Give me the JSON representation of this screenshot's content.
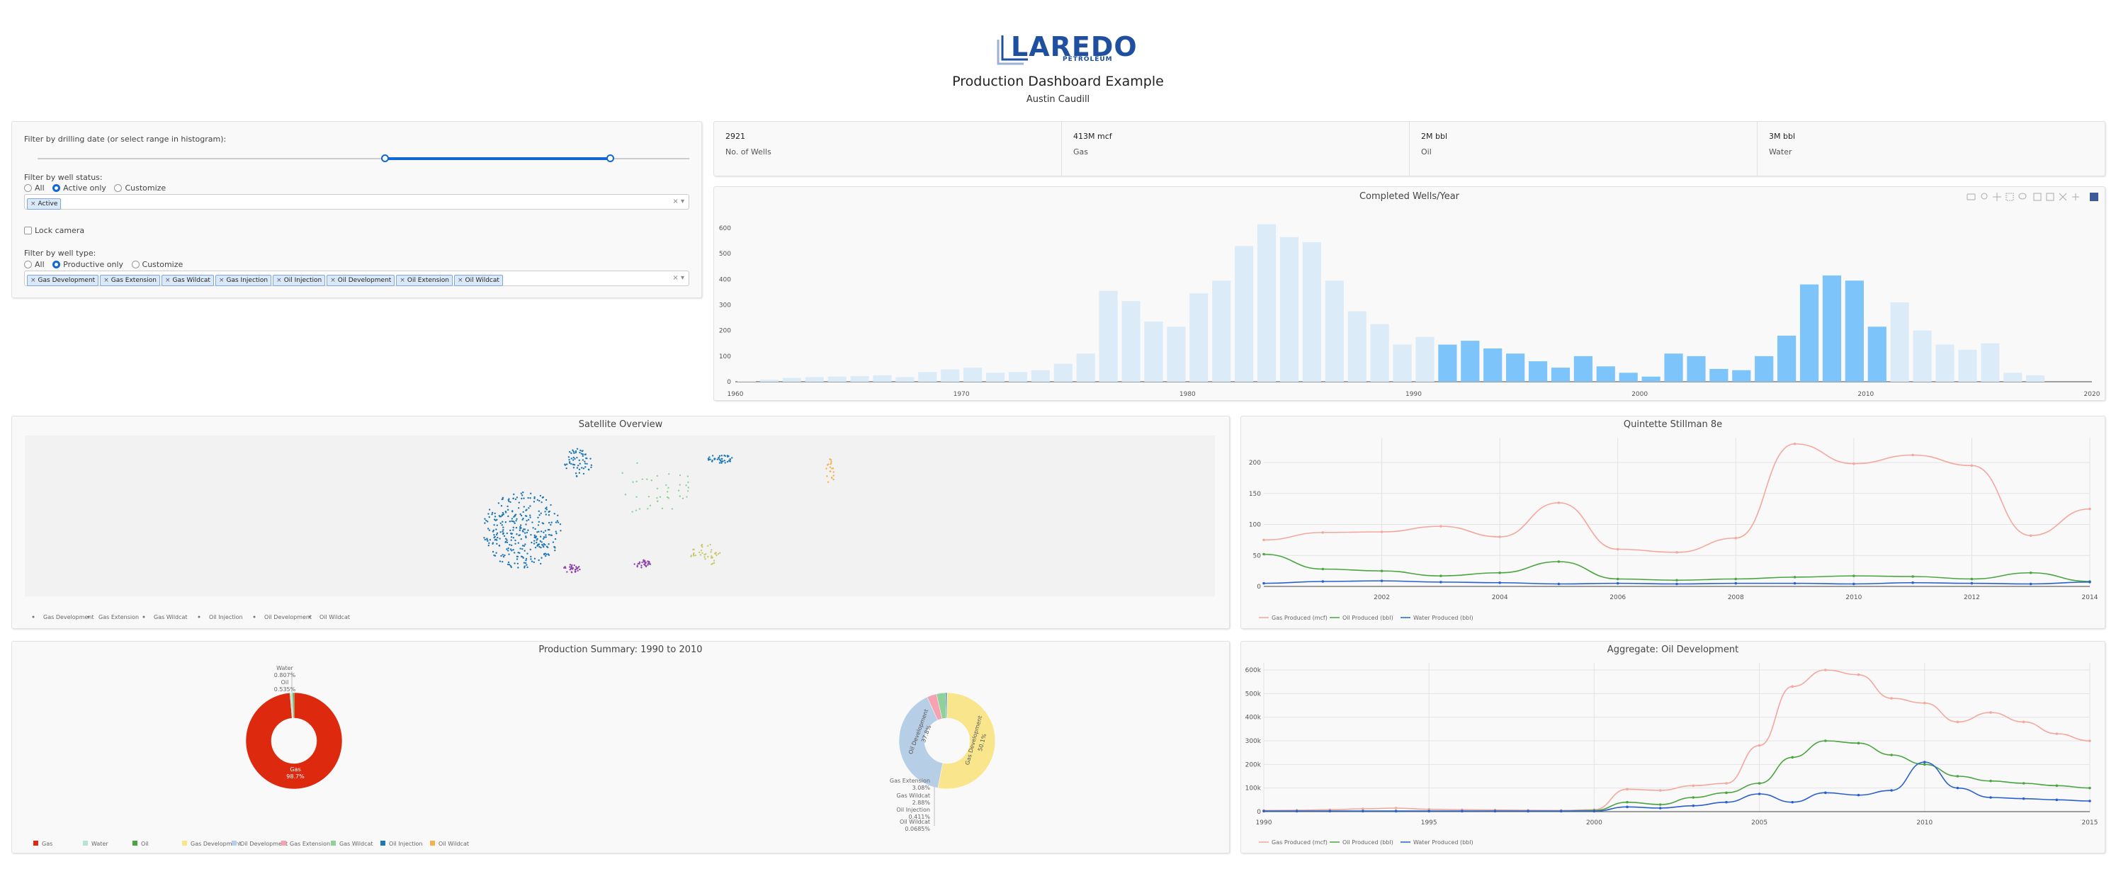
{
  "header": {
    "logo_text": "LAREDO",
    "logo_sub": "PETROLEUM",
    "title": "Production Dashboard Example",
    "author": "Austin Caudill"
  },
  "controls": {
    "date_label": "Filter by drilling date (or select range in histogram):",
    "date_range": {
      "start": 1990,
      "end": 2010,
      "min": 1960,
      "max": 2020
    },
    "status_label": "Filter by well status:",
    "status_options": [
      "All",
      "Active only",
      "Customize"
    ],
    "status_selected": "Active only",
    "status_tags": [
      "Active"
    ],
    "lock_camera": "Lock camera",
    "type_label": "Filter by well type:",
    "type_options": [
      "All",
      "Productive only",
      "Customize"
    ],
    "type_selected": "Productive only",
    "type_tags": [
      "Gas Development",
      "Gas Extension",
      "Gas Wildcat",
      "Gas Injection",
      "Oil Injection",
      "Oil Development",
      "Oil Extension",
      "Oil Wildcat"
    ],
    "clear_glyph": "×",
    "caret_glyph": "▾"
  },
  "stats": [
    {
      "value": "2921",
      "label": "No. of Wells"
    },
    {
      "value": "413M mcf",
      "label": "Gas"
    },
    {
      "value": "2M bbl",
      "label": "Oil"
    },
    {
      "value": "3M bbl",
      "label": "Water"
    }
  ],
  "colors": {
    "accent": "#1166d8",
    "bar_selected": "#7cc4fa",
    "bar_dim": "#dcebf8",
    "gas": "#f4a79d",
    "oil": "#4aa540",
    "water": "#2a5fd0"
  },
  "icons": [
    "camera-icon",
    "zoom-icon",
    "pan-icon",
    "box-select-icon",
    "lasso-icon",
    "zoom-in-icon",
    "zoom-out-icon",
    "autoscale-icon",
    "reset-icon",
    "plotly-logo-icon"
  ],
  "chart_data": [
    {
      "type": "bar",
      "title": "Completed Wells/Year",
      "x": [
        1960,
        1961,
        1962,
        1963,
        1964,
        1965,
        1966,
        1967,
        1968,
        1969,
        1970,
        1971,
        1972,
        1973,
        1974,
        1975,
        1976,
        1977,
        1978,
        1979,
        1980,
        1981,
        1982,
        1983,
        1984,
        1985,
        1986,
        1987,
        1988,
        1989,
        1990,
        1991,
        1992,
        1993,
        1994,
        1995,
        1996,
        1997,
        1998,
        1999,
        2000,
        2001,
        2002,
        2003,
        2004,
        2005,
        2006,
        2007,
        2008,
        2009,
        2010,
        2011,
        2012,
        2013,
        2014,
        2015,
        2016,
        2017
      ],
      "values": [
        2,
        8,
        15,
        18,
        20,
        22,
        25,
        18,
        38,
        48,
        55,
        35,
        38,
        45,
        70,
        110,
        355,
        315,
        235,
        215,
        345,
        395,
        530,
        615,
        565,
        545,
        395,
        275,
        225,
        145,
        175,
        145,
        160,
        130,
        110,
        80,
        55,
        100,
        60,
        35,
        20,
        110,
        100,
        50,
        45,
        100,
        180,
        380,
        415,
        395,
        215,
        310,
        200,
        145,
        125,
        150,
        35,
        25
      ],
      "selected_range": [
        1991,
        2010
      ],
      "xticks": [
        1960,
        1970,
        1980,
        1990,
        2000,
        2010,
        2020
      ],
      "yticks": [
        0,
        100,
        200,
        300,
        400,
        500,
        600
      ],
      "ylim": [
        0,
        650
      ]
    },
    {
      "type": "scatter",
      "title": "Satellite Overview",
      "legend": [
        "Gas Development",
        "Gas Extension",
        "Gas Wildcat",
        "Oil Injection",
        "Oil Development",
        "Oil Wildcat"
      ]
    },
    {
      "type": "line",
      "title": "Quintette Stillman 8e",
      "x": [
        2000,
        2001,
        2002,
        2003,
        2004,
        2005,
        2006,
        2007,
        2008,
        2009,
        2010,
        2011,
        2012,
        2013,
        2014,
        2015
      ],
      "xticks": [
        2002,
        2004,
        2006,
        2008,
        2010,
        2012,
        2014
      ],
      "yticks": [
        0,
        50,
        100,
        150,
        200
      ],
      "ylim": [
        0,
        240
      ],
      "series": [
        {
          "name": "Gas Produced (mcf)",
          "color": "#f4a79d",
          "values": [
            75,
            87,
            88,
            97,
            80,
            135,
            60,
            55,
            78,
            230,
            198,
            212,
            195,
            82,
            125
          ]
        },
        {
          "name": "Oil Produced (bbl)",
          "color": "#4aa540",
          "values": [
            52,
            28,
            25,
            17,
            22,
            40,
            12,
            10,
            12,
            15,
            17,
            16,
            12,
            22,
            8
          ]
        },
        {
          "name": "Water Produced (bbl)",
          "color": "#2a5fd0",
          "values": [
            5,
            8,
            9,
            7,
            6,
            4,
            5,
            4,
            5,
            5,
            4,
            6,
            5,
            4,
            7
          ]
        }
      ]
    },
    {
      "type": "pie",
      "title": "Production Summary: 1990 to 2010",
      "pies": [
        {
          "slices": [
            {
              "label": "Gas",
              "value": 98.7,
              "text": "98.7%",
              "color": "#dd2a0e"
            },
            {
              "label": "Water",
              "value": 0.807,
              "text": "0.807%",
              "color": "#b7e3d0"
            },
            {
              "label": "Oil",
              "value": 0.535,
              "text": "0.535%",
              "color": "#4aa540"
            }
          ]
        },
        {
          "slices": [
            {
              "label": "Gas Development",
              "value": 50.1,
              "text": "50.1%",
              "color": "#f9e58c"
            },
            {
              "label": "Oil Development",
              "value": 37.8,
              "text": "37.8%",
              "color": "#b6cfe6"
            },
            {
              "label": "Gas Extension",
              "value": 3.08,
              "text": "3.08%",
              "color": "#f5a3b3"
            },
            {
              "label": "Gas Wildcat",
              "value": 2.88,
              "text": "2.88%",
              "color": "#8fd19a"
            },
            {
              "label": "Oil Injection",
              "value": 0.411,
              "text": "0.411%",
              "color": "#1f77b4"
            },
            {
              "label": "Oil Wildcat",
              "value": 0.0685,
              "text": "0.0685%",
              "color": "#f5b050"
            }
          ]
        }
      ],
      "legend": [
        "Gas",
        "Water",
        "Oil",
        "Gas Development",
        "Oil Development",
        "Gas Extension",
        "Gas Wildcat",
        "Oil Injection",
        "Oil Wildcat"
      ]
    },
    {
      "type": "line",
      "title": "Aggregate: Oil Development",
      "x": [
        1990,
        1991,
        1992,
        1993,
        1994,
        1995,
        1996,
        1997,
        1998,
        1999,
        2000,
        2001,
        2002,
        2003,
        2004,
        2005,
        2006,
        2007,
        2008,
        2009,
        2010,
        2011,
        2012,
        2013,
        2014,
        2015
      ],
      "xticks": [
        1990,
        1995,
        2000,
        2005,
        2010,
        2015
      ],
      "ytick_labels": [
        "0",
        "100k",
        "200k",
        "300k",
        "400k",
        "500k",
        "600k"
      ],
      "ylim": [
        0,
        630000
      ],
      "series": [
        {
          "name": "Gas Produced (mcf)",
          "color": "#f4a79d",
          "values": [
            5000,
            6000,
            8000,
            12000,
            15000,
            10000,
            8000,
            7000,
            6000,
            5000,
            8000,
            95000,
            90000,
            110000,
            120000,
            280000,
            530000,
            600000,
            580000,
            480000,
            460000,
            380000,
            420000,
            380000,
            330000,
            300000
          ]
        },
        {
          "name": "Oil Produced (bbl)",
          "color": "#4aa540",
          "values": [
            3000,
            3000,
            3000,
            3000,
            3000,
            3000,
            3000,
            3000,
            3000,
            3000,
            5000,
            40000,
            30000,
            60000,
            80000,
            120000,
            230000,
            300000,
            290000,
            240000,
            200000,
            150000,
            130000,
            120000,
            110000,
            100000
          ]
        },
        {
          "name": "Water Produced (bbl)",
          "color": "#2a5fd0",
          "values": [
            2000,
            2000,
            2000,
            2000,
            2000,
            2000,
            2000,
            2000,
            2000,
            2000,
            2000,
            20000,
            15000,
            25000,
            40000,
            75000,
            40000,
            80000,
            70000,
            90000,
            210000,
            100000,
            60000,
            55000,
            50000,
            45000
          ]
        }
      ]
    }
  ]
}
